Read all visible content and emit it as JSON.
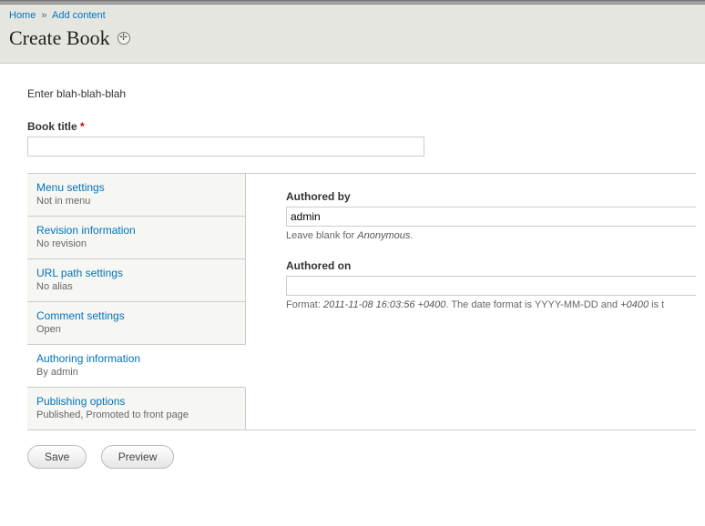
{
  "breadcrumb": {
    "home": "Home",
    "sep": "»",
    "addcontent": "Add content"
  },
  "page": {
    "title": "Create Book"
  },
  "intro": "Enter blah-blah-blah",
  "title_field": {
    "label": "Book title",
    "req": "*",
    "value": ""
  },
  "tabs": [
    {
      "title": "Menu settings",
      "sub": "Not in menu"
    },
    {
      "title": "Revision information",
      "sub": "No revision"
    },
    {
      "title": "URL path settings",
      "sub": "No alias"
    },
    {
      "title": "Comment settings",
      "sub": "Open"
    },
    {
      "title": "Authoring information",
      "sub": "By admin"
    },
    {
      "title": "Publishing options",
      "sub": "Published, Promoted to front page"
    }
  ],
  "author": {
    "by_label": "Authored by",
    "by_value": "admin",
    "by_hint_pre": "Leave blank for ",
    "by_hint_em": "Anonymous",
    "by_hint_post": ".",
    "on_label": "Authored on",
    "on_value": "",
    "on_hint_pre": "Format: ",
    "on_hint_em1": "2011-11-08 16:03:56 +0400",
    "on_hint_mid": ". The date format is YYYY-MM-DD and ",
    "on_hint_em2": "+0400",
    "on_hint_post": " is t"
  },
  "buttons": {
    "save": "Save",
    "preview": "Preview"
  }
}
